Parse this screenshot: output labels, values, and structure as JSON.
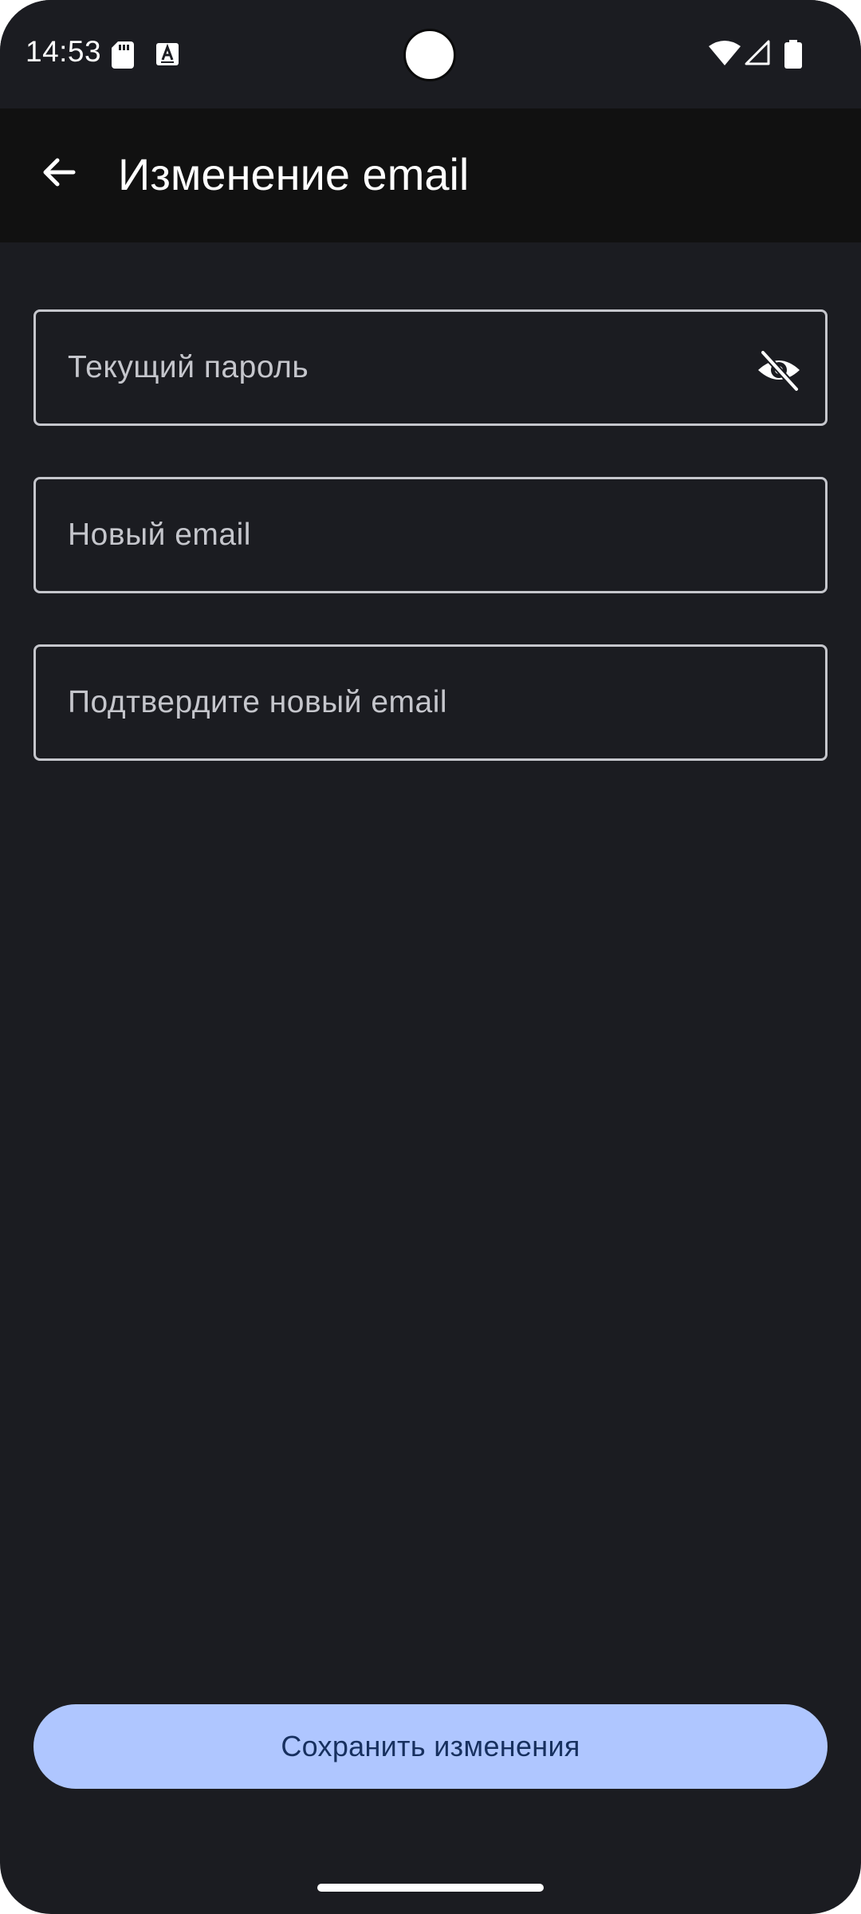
{
  "status_bar": {
    "time": "14:53",
    "icons": [
      "sd-card-icon",
      "keyboard-a-icon",
      "wifi-icon",
      "signal-icon",
      "battery-icon"
    ]
  },
  "app_bar": {
    "title": "Изменение email",
    "back_icon": "arrow-back-icon"
  },
  "form": {
    "current_password": {
      "placeholder": "Текущий пароль",
      "value": "",
      "visibility_icon": "visibility-off-icon"
    },
    "new_email": {
      "placeholder": "Новый email",
      "value": ""
    },
    "confirm_email": {
      "placeholder": "Подтвердите новый email",
      "value": ""
    }
  },
  "actions": {
    "save_label": "Сохранить изменения"
  },
  "colors": {
    "background": "#1b1c21",
    "app_bar": "#111111",
    "primary_button": "#afc6ff",
    "primary_button_text": "#17305f",
    "field_border": "#c5c6cc"
  }
}
